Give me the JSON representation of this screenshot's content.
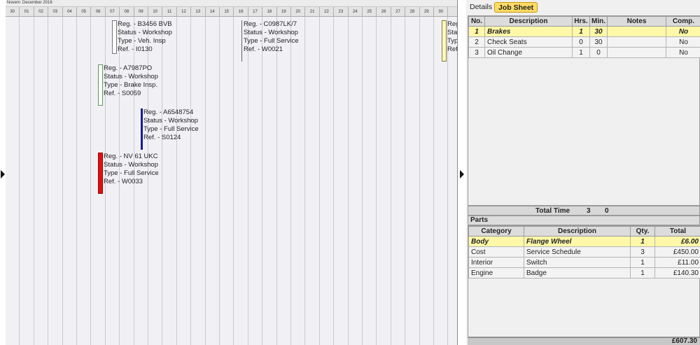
{
  "calendar": {
    "month_prev": "Novem",
    "month_current": "December 2016",
    "days": [
      "30",
      "01",
      "02",
      "03",
      "04",
      "05",
      "06",
      "07",
      "08",
      "09",
      "10",
      "11",
      "12",
      "13",
      "14",
      "15",
      "16",
      "17",
      "18",
      "19",
      "20",
      "21",
      "22",
      "23",
      "24",
      "25",
      "26",
      "27",
      "28",
      "29",
      "30"
    ],
    "jobs": [
      {
        "reg": "Reg. - B3456 BVB",
        "status": "Status - Workshop",
        "type": "Type - Veh. Insp",
        "ref": "Ref. - I0130",
        "color": "#ffffff"
      },
      {
        "reg": "Reg. - C0987LK/7",
        "status": "Status - Workshop",
        "type": "Type - Full Service",
        "ref": "Ref. - W0021",
        "color": "#ffffff"
      },
      {
        "reg": "Reg. - A7987PO",
        "status": "Status - Workshop",
        "type": "Type - Brake Insp.",
        "ref": "Ref. - S0059",
        "color": "#ffffff"
      },
      {
        "reg": "Reg. - A6548754",
        "status": "Status - Workshop",
        "type": "Type - Full Service",
        "ref": "Ref. - S0124",
        "color": "#1a1a9a"
      },
      {
        "reg": "Reg. - NV 61 UKC",
        "status": "Status - Workshop",
        "type": "Type - Full Service",
        "ref": "Ref. - W0033",
        "color": "#e01010"
      },
      {
        "reg": "Reg",
        "status": "Stat",
        "type": "Typ",
        "ref": "Ref",
        "color": "#fff8c0"
      }
    ]
  },
  "tabs": {
    "details": "Details",
    "job_sheet": "Job Sheet"
  },
  "job_sheet": {
    "headers": [
      "No.",
      "Description",
      "Hrs.",
      "Min.",
      "Notes",
      "Comp."
    ],
    "rows": [
      {
        "no": "1",
        "description": "Brakes",
        "hrs": "1",
        "min": "30",
        "notes": "",
        "comp": "No"
      },
      {
        "no": "2",
        "description": "Check Seats",
        "hrs": "0",
        "min": "30",
        "notes": "",
        "comp": "No"
      },
      {
        "no": "3",
        "description": "Oil Change",
        "hrs": "1",
        "min": "0",
        "notes": "",
        "comp": "No"
      }
    ],
    "total_time_label": "Total Time",
    "total_hrs": "3",
    "total_min": "0"
  },
  "parts": {
    "title": "Parts",
    "headers": [
      "Category",
      "Description",
      "Qty.",
      "Total"
    ],
    "rows": [
      {
        "category": "Body",
        "description": "Flange Wheel",
        "qty": "1",
        "total": "£6.00"
      },
      {
        "category": "Cost",
        "description": "Service Schedule",
        "qty": "3",
        "total": "£450.00"
      },
      {
        "category": "Interior",
        "description": "Switch",
        "qty": "1",
        "total": "£11.00"
      },
      {
        "category": "Engine",
        "description": "Badge",
        "qty": "1",
        "total": "£140.30"
      }
    ],
    "grand_total": "£607.30"
  },
  "colors": {
    "selected_row": "#fff8a8",
    "active_tab": "#fddc64"
  }
}
